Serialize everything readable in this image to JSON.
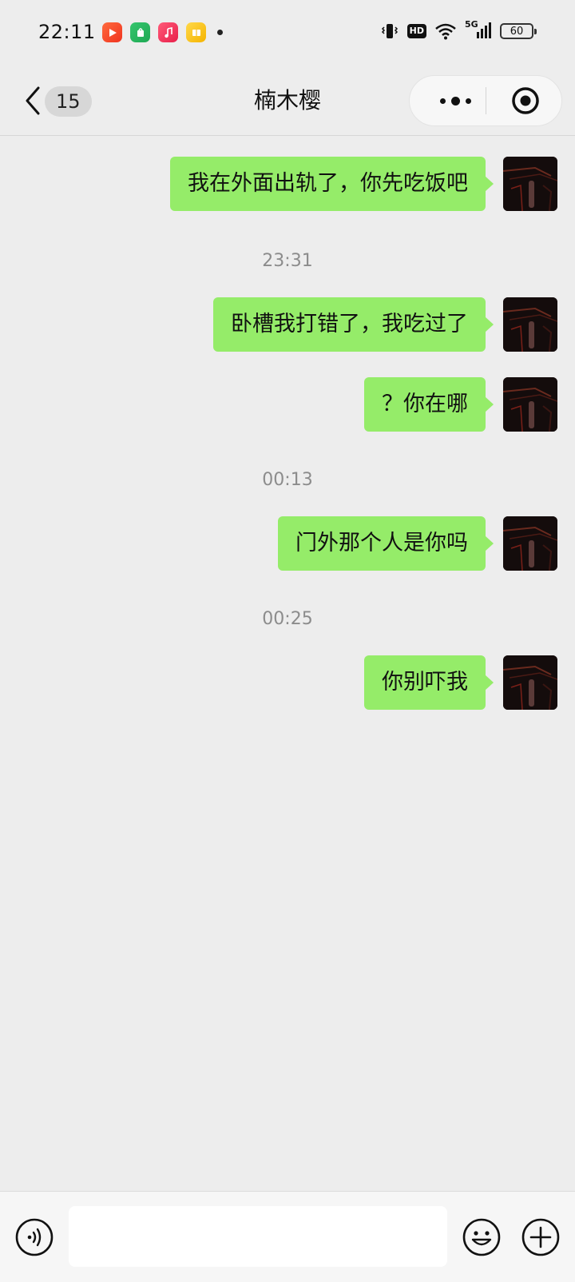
{
  "status_bar": {
    "time": "22:11",
    "app_icons": [
      "video-app-icon",
      "shop-app-icon",
      "music-app-icon",
      "book-app-icon"
    ],
    "network": "5G",
    "hd_label": "HD",
    "battery": "60"
  },
  "header": {
    "unread_count": "15",
    "contact_name": "楠木樱"
  },
  "messages": [
    {
      "text": "我在外面出轨了，你先吃饭吧"
    },
    {
      "timestamp": "23:31"
    },
    {
      "text": "卧槽我打错了，我吃过了"
    },
    {
      "text": "？你在哪"
    },
    {
      "timestamp": "00:13"
    },
    {
      "text": "门外那个人是你吗"
    },
    {
      "timestamp": "00:25"
    },
    {
      "text": "你别吓我"
    }
  ],
  "input": {
    "value": "",
    "placeholder": ""
  },
  "colors": {
    "bubble": "#95ec69",
    "background": "#ededed",
    "timestamp": "#8c8c8c"
  }
}
